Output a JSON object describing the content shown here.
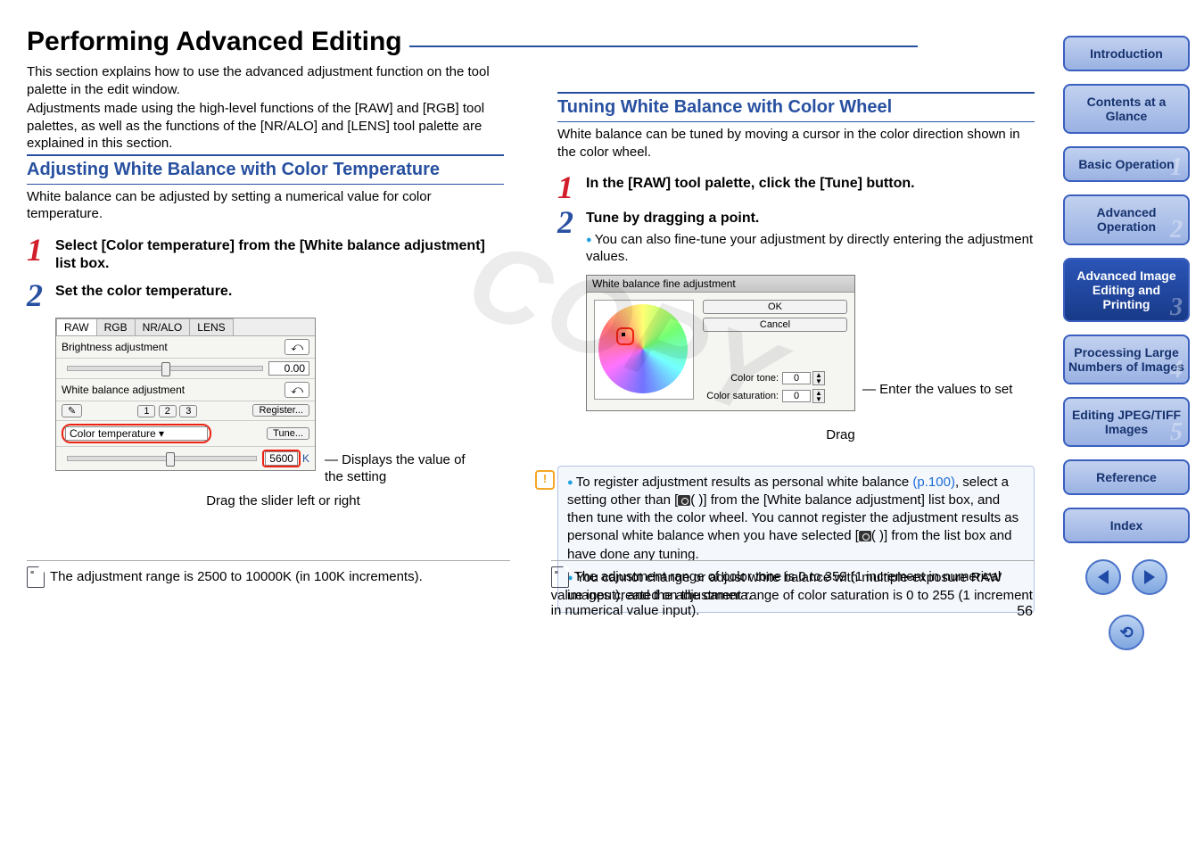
{
  "page": {
    "title": "Performing Advanced Editing",
    "intro1": "This section explains how to use the advanced adjustment function on the tool palette in the edit window.",
    "intro2": "Adjustments made using the high-level functions of the [RAW] and [RGB] tool palettes, as well as the functions of the [NR/ALO] and [LENS] tool palette are explained in this section.",
    "page_number": "56",
    "watermark": "COPY"
  },
  "left": {
    "h2": "Adjusting White Balance with Color Temperature",
    "lead": "White balance can be adjusted by setting a numerical value for color temperature.",
    "step1": "Select [Color temperature] from the [White balance adjustment] list box.",
    "step2": "Set the color temperature.",
    "palette": {
      "tabs": [
        "RAW",
        "RGB",
        "NR/ALO",
        "LENS"
      ],
      "brightness_label": "Brightness adjustment",
      "brightness_value": "0.00",
      "wb_label": "White balance adjustment",
      "preset_buttons": [
        "1",
        "2",
        "3"
      ],
      "register": "Register...",
      "dropdown_value": "Color temperature",
      "tune": "Tune...",
      "kelvin_value": "5600",
      "k": "K"
    },
    "callout_right": "Displays the value of the setting",
    "callout_under": "Drag the slider left or right",
    "footnote": "The adjustment range is 2500 to 10000K (in 100K increments)."
  },
  "right": {
    "h2": "Tuning White Balance with Color Wheel",
    "lead": "White balance can be tuned by moving a cursor in the color direction shown in the color wheel.",
    "step1": "In the [RAW] tool palette, click the [Tune] button.",
    "step2": "Tune by dragging a point.",
    "step2_sub": "You can also fine-tune your adjustment by directly entering the adjustment values.",
    "dialog": {
      "title": "White balance fine adjustment",
      "ok": "OK",
      "cancel": "Cancel",
      "color_tone_label": "Color tone:",
      "color_tone_value": "0",
      "color_sat_label": "Color saturation:",
      "color_sat_value": "0"
    },
    "enter_values": "Enter the values to set",
    "drag": "Drag",
    "warn1a": "To register adjustment results as personal white balance ",
    "warn1link": "(p.100)",
    "warn1b": ", select a setting other than [",
    "warn1c": "( )] from the [White balance adjustment] list box, and then tune with the color wheel. You cannot register the adjustment results as personal white balance when you have selected [",
    "warn1d": "( )] from the list box and have done any tuning.",
    "warn2": "You cannot change or adjust white balance with multiple-exposure RAW images created on the camera.",
    "footnote": "The adjustment range of color tone is 0 to 359 (1 increment in numerical value input), and the adjustment range of color saturation is 0 to 255 (1 increment in numerical value input)."
  },
  "nav": {
    "intro": "Introduction",
    "contents": "Contents at a Glance",
    "basic": "Basic Operation",
    "adv": "Advanced Operation",
    "advimg": "Advanced Image Editing and Printing",
    "proc": "Processing Large Numbers of Images",
    "jpeg": "Editing JPEG/TIFF Images",
    "ref": "Reference",
    "index": "Index"
  }
}
